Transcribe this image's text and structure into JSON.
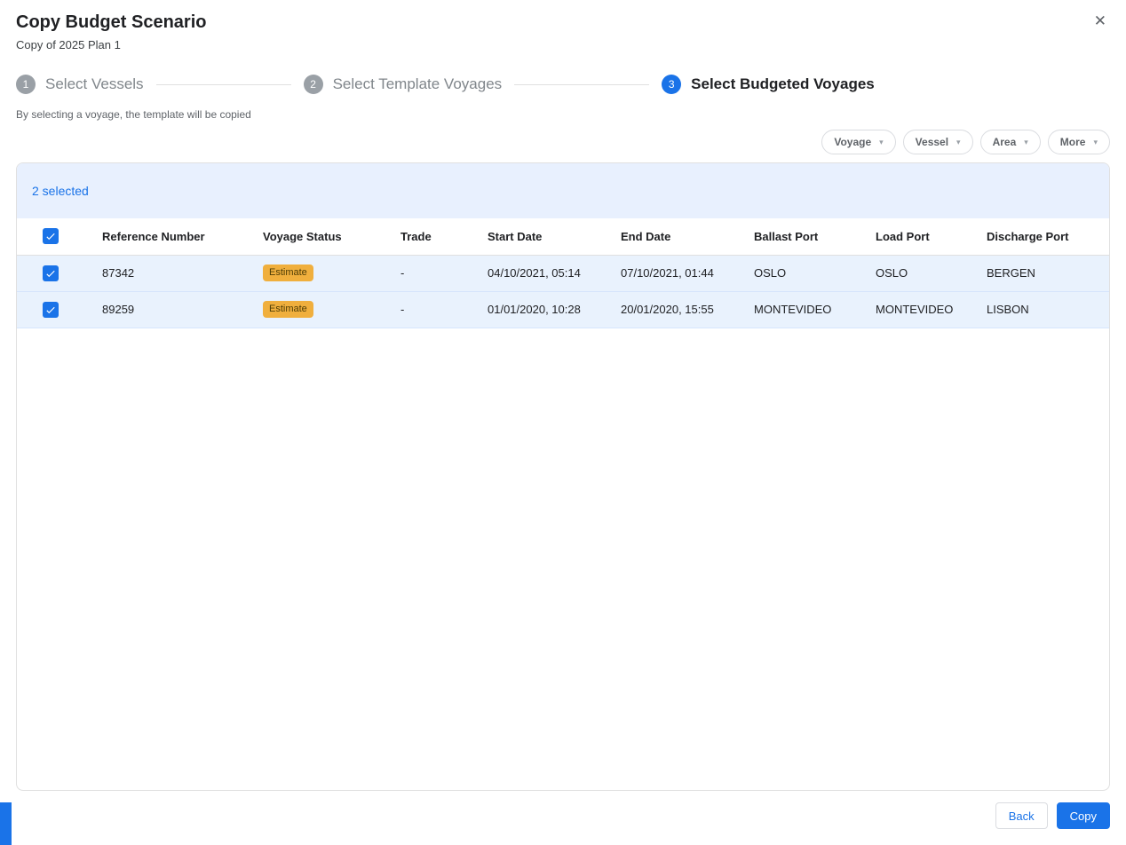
{
  "modal": {
    "title": "Copy Budget Scenario",
    "subtitle": "Copy of 2025 Plan 1"
  },
  "icons": {
    "close": "✕",
    "caret": "▾"
  },
  "stepper": {
    "steps": [
      {
        "number": "1",
        "label": "Select Vessels",
        "active": false
      },
      {
        "number": "2",
        "label": "Select Template Voyages",
        "active": false
      },
      {
        "number": "3",
        "label": "Select Budgeted Voyages",
        "active": true
      }
    ]
  },
  "hint": "By selecting a voyage, the template will be copied",
  "filters": [
    {
      "label": "Voyage"
    },
    {
      "label": "Vessel"
    },
    {
      "label": "Area"
    },
    {
      "label": "More"
    }
  ],
  "table": {
    "selected_count": "2 selected",
    "columns": [
      "Reference Number",
      "Voyage Status",
      "Trade",
      "Start Date",
      "End Date",
      "Ballast Port",
      "Load Port",
      "Discharge Port"
    ],
    "rows": [
      {
        "checked": true,
        "reference": "87342",
        "status": "Estimate",
        "trade": "-",
        "start": "04/10/2021, 05:14",
        "end": "07/10/2021, 01:44",
        "ballast": "OSLO",
        "load": "OSLO",
        "discharge": "BERGEN"
      },
      {
        "checked": true,
        "reference": "89259",
        "status": "Estimate",
        "trade": "-",
        "start": "01/01/2020, 10:28",
        "end": "20/01/2020, 15:55",
        "ballast": "MONTEVIDEO",
        "load": "MONTEVIDEO",
        "discharge": "LISBON"
      }
    ]
  },
  "footer": {
    "back_label": "Back",
    "copy_label": "Copy"
  },
  "colors": {
    "primary": "#1a73e8",
    "selection_band_bg": "#e8f0fe",
    "selected_row_bg": "#e9f2fd",
    "badge_bg": "#f0af3d",
    "badge_text": "#4d3c05",
    "inactive_step": "#9aa0a6"
  }
}
